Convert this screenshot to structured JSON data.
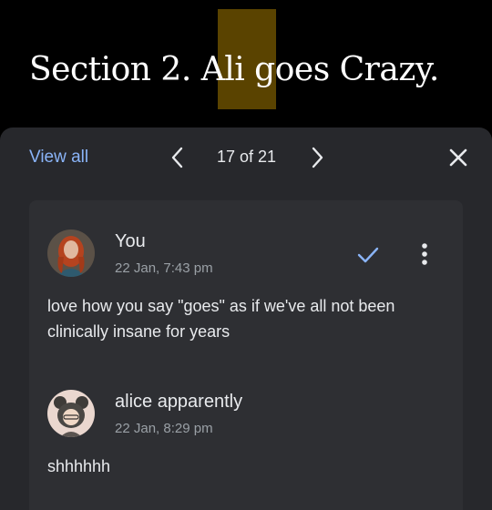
{
  "document": {
    "heading_before": "Section 2. Ali ",
    "heading_highlight": "goes",
    "heading_after": " Crazy."
  },
  "toolbar": {
    "view_all": "View all",
    "counter": "17 of 21",
    "prev_icon": "chevron-left-icon",
    "next_icon": "chevron-right-icon",
    "close_icon": "close-icon"
  },
  "comments": [
    {
      "author": "You",
      "timestamp": "22 Jan, 7:43 pm",
      "text_line1": "love how you say \"goes\" as if we've all not been",
      "text_line2": "clinically insane for years"
    },
    {
      "author": "alice apparently",
      "timestamp": "22 Jan, 8:29 pm",
      "text_line1": "shhhhhh"
    }
  ],
  "colors": {
    "accent": "#8ab4f8",
    "highlight": "#5a4300",
    "panel": "#27282c",
    "card": "#2e2f33"
  }
}
